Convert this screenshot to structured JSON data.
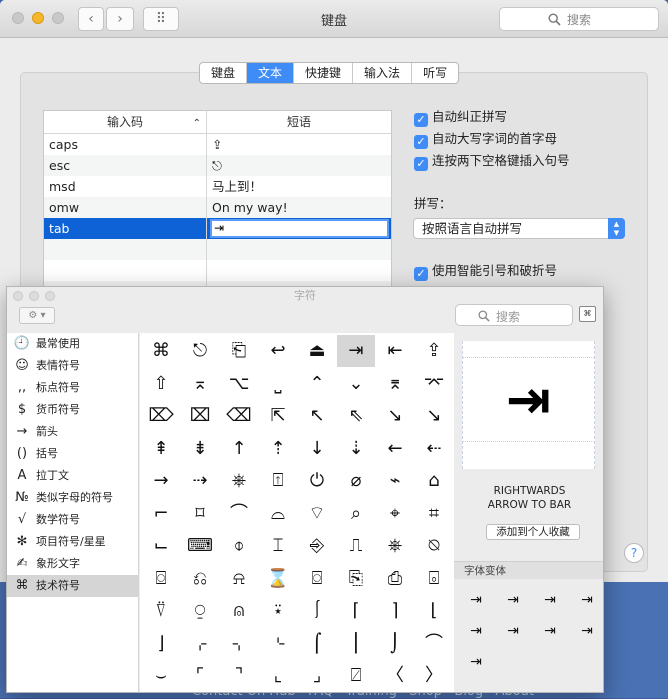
{
  "window": {
    "title": "键盘",
    "search_placeholder": "搜索",
    "back_icon": "‹",
    "forward_icon": "›",
    "grid_icon": "⠿"
  },
  "tabs": [
    {
      "label": "键盘",
      "active": false
    },
    {
      "label": "文本",
      "active": true
    },
    {
      "label": "快捷键",
      "active": false
    },
    {
      "label": "输入法",
      "active": false
    },
    {
      "label": "听写",
      "active": false
    }
  ],
  "table": {
    "col_input": "输入码",
    "col_phrase": "短语",
    "sort_icon": "⌃",
    "rows": [
      {
        "input": "caps",
        "phrase": "⇪",
        "selected": false
      },
      {
        "input": "esc",
        "phrase": "⎋",
        "selected": false
      },
      {
        "input": "msd",
        "phrase": "马上到！",
        "selected": false
      },
      {
        "input": "omw",
        "phrase": "On my way!",
        "selected": false
      },
      {
        "input": "tab",
        "phrase": "⇥",
        "selected": true
      }
    ]
  },
  "options": [
    {
      "label": "自动纠正拼写",
      "checked": true
    },
    {
      "label": "自动大写字词的首字母",
      "checked": true
    },
    {
      "label": "连按两下空格键插入句号",
      "checked": true
    }
  ],
  "spelling": {
    "label": "拼写：",
    "value": "按照语言自动拼写"
  },
  "smart_quotes": {
    "label": "使用智能引号和破折号",
    "checked": true
  },
  "help_label": "?",
  "bottom_links": "Contact On Hub   FAQ   Training   Shop   Blog   About",
  "char_viewer": {
    "title": "字符",
    "gear_label": "⚙ ▾",
    "search_placeholder": "搜索",
    "view_icon": "⌘",
    "categories": [
      {
        "icon": "🕘",
        "label": "最常使用",
        "selected": false
      },
      {
        "icon": "☺",
        "label": "表情符号",
        "selected": false
      },
      {
        "icon": ",,",
        "label": "标点符号",
        "selected": false
      },
      {
        "icon": "$",
        "label": "货币符号",
        "selected": false
      },
      {
        "icon": "→",
        "label": "箭头",
        "selected": false
      },
      {
        "icon": "()",
        "label": "括号",
        "selected": false
      },
      {
        "icon": "A",
        "label": "拉丁文",
        "selected": false
      },
      {
        "icon": "№",
        "label": "类似字母的符号",
        "selected": false
      },
      {
        "icon": "√",
        "label": "数学符号",
        "selected": false
      },
      {
        "icon": "✻",
        "label": "项目符号/星星",
        "selected": false
      },
      {
        "icon": "✍",
        "label": "象形文字",
        "selected": false
      },
      {
        "icon": "⌘",
        "label": "技术符号",
        "selected": true
      }
    ],
    "chars": [
      "⌘",
      "⎋",
      "⎗",
      "↩",
      "⏏",
      "⇥",
      "⇤",
      "⇪",
      "⇧",
      "⌅",
      "⌥",
      "⎵",
      "⌃",
      "⌄",
      "⌆",
      "⌤",
      "⌦",
      "⌧",
      "⌫",
      "⇱",
      "↖",
      "⇖",
      "↘",
      "↘",
      "⇞",
      "⇟",
      "↑",
      "⇡",
      "↓",
      "⇣",
      "←",
      "⇠",
      "→",
      "⇢",
      "⎈",
      "⍐",
      "⏻",
      "⌀",
      "⌁",
      "⌂",
      "⌐",
      "⌑",
      "⌒",
      "⌓",
      "⌔",
      "⌕",
      "⌖",
      "⌗",
      "⌙",
      "⌨",
      "⌽",
      "⌶",
      "⎆",
      "⎍",
      "⎈",
      "⍉",
      "⌼",
      "⎌",
      "⍾",
      "⌛",
      "⌼",
      "⎘",
      "⎙",
      "⌻",
      "⍢",
      "⍜",
      "⍝",
      "⍣",
      "⎰",
      "⌈",
      "⌉",
      "⌊",
      "⌋",
      "⌌",
      "⌍",
      "⌎",
      "⌠",
      "⎮",
      "⌡",
      "⌒",
      "⌣",
      "⌜",
      "⌝",
      "⌞",
      "⌟",
      "⍁",
      "〈",
      "〉"
    ],
    "selected_index": 5,
    "detail": {
      "glyph": "⇥",
      "name": "RIGHTWARDS\nARROW TO BAR",
      "fav_label": "添加到个人收藏",
      "variants_label": "字体变体",
      "variants": [
        "⇥",
        "⇥",
        "⇥",
        "⇥",
        "⇥",
        "⇥",
        "⇥",
        "⇥",
        "⇥"
      ]
    }
  }
}
